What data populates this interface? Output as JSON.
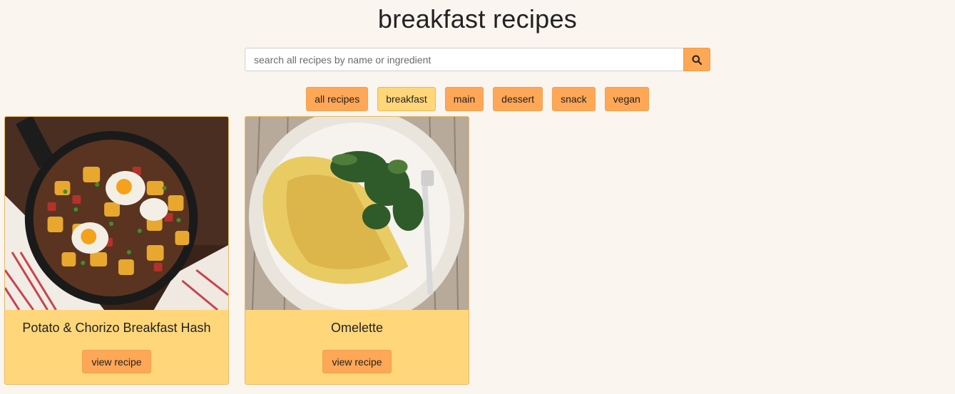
{
  "page": {
    "title": "breakfast recipes"
  },
  "search": {
    "placeholder": "search all recipes by name or ingredient",
    "value": "",
    "button_icon": "search-icon"
  },
  "filters": [
    {
      "label": "all recipes",
      "active": false
    },
    {
      "label": "breakfast",
      "active": true
    },
    {
      "label": "main",
      "active": false
    },
    {
      "label": "dessert",
      "active": false
    },
    {
      "label": "snack",
      "active": false
    },
    {
      "label": "vegan",
      "active": false
    }
  ],
  "recipes": [
    {
      "title": "Potato & Chorizo Breakfast Hash",
      "button_label": "view recipe",
      "image": "potato-chorizo-hash-photo"
    },
    {
      "title": "Omelette",
      "button_label": "view recipe",
      "image": "omelette-photo"
    }
  ],
  "colors": {
    "background": "#fbf5ef",
    "accent": "#fea756",
    "active": "#ffd77a"
  }
}
